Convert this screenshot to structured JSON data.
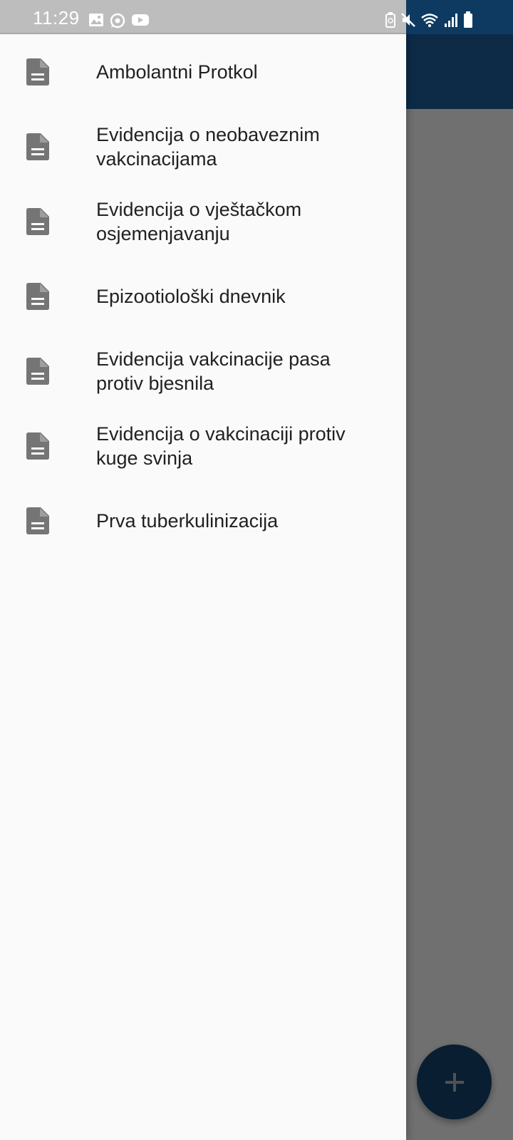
{
  "status_bar": {
    "time": "11:29",
    "left_icons": [
      "image-icon",
      "whatsapp-icon",
      "youtube-icon"
    ],
    "right_icons": [
      "battery-saver-icon",
      "mute-icon",
      "wifi-icon",
      "signal-icon",
      "battery-icon"
    ]
  },
  "drawer": {
    "items": [
      {
        "label": "Ambolantni Protkol",
        "icon": "document-icon"
      },
      {
        "label": "Evidencija o neobaveznim vakcinacijama",
        "icon": "document-icon"
      },
      {
        "label": "Evidencija o vještačkom osjemenjavanju",
        "icon": "document-icon"
      },
      {
        "label": "Epizootiološki dnevnik",
        "icon": "document-icon"
      },
      {
        "label": "Evidencija vakcinacije pasa protiv bjesnila",
        "icon": "document-icon"
      },
      {
        "label": "Evidencija o vakcinaciji protiv kuge svinja",
        "icon": "document-icon"
      },
      {
        "label": "Prva tuberkulinizacija",
        "icon": "document-icon"
      }
    ]
  },
  "fab": {
    "label": "+",
    "icon": "plus-icon"
  },
  "colors": {
    "primary": "#1e5f9c",
    "drawer_bg": "#fafafa",
    "icon_gray": "#757575",
    "text": "#212121"
  }
}
